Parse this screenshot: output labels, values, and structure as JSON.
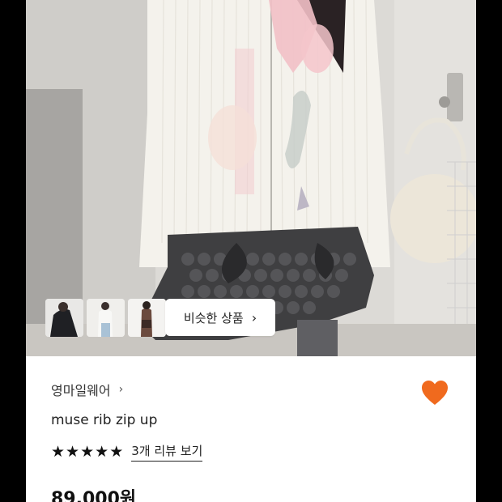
{
  "product_image": {
    "alt": "muse rib zip up"
  },
  "thumbnails": [
    {
      "name": "thumb-1"
    },
    {
      "name": "thumb-2"
    },
    {
      "name": "thumb-3"
    }
  ],
  "similar_products": {
    "label": "비슷한 상품",
    "chevron": "›"
  },
  "store": {
    "name": "영마일웨어",
    "chevron": "›"
  },
  "product": {
    "title": "muse rib zip up",
    "price": "89,000원"
  },
  "rating": {
    "stars": 5,
    "review_label": "3개 리뷰 보기"
  },
  "icons": {
    "wishlist": "heart-icon",
    "star": "star-icon"
  },
  "colors": {
    "heart": "#F06A1E",
    "text": "#222222"
  }
}
